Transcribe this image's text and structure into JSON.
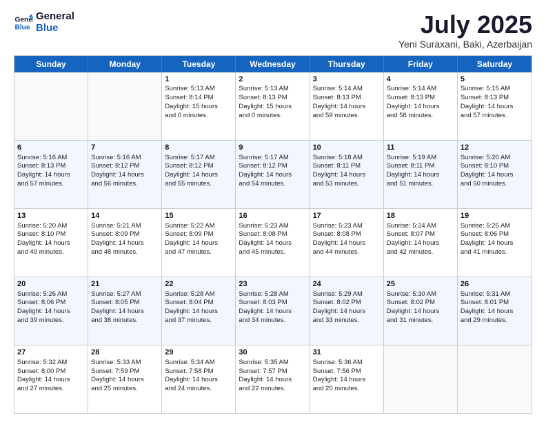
{
  "logo": {
    "line1": "General",
    "line2": "Blue"
  },
  "title": "July 2025",
  "subtitle": "Yeni Suraxani, Baki, Azerbaijan",
  "days": [
    "Sunday",
    "Monday",
    "Tuesday",
    "Wednesday",
    "Thursday",
    "Friday",
    "Saturday"
  ],
  "rows": [
    [
      {
        "day": "",
        "lines": []
      },
      {
        "day": "",
        "lines": []
      },
      {
        "day": "1",
        "lines": [
          "Sunrise: 5:13 AM",
          "Sunset: 8:14 PM",
          "Daylight: 15 hours",
          "and 0 minutes."
        ]
      },
      {
        "day": "2",
        "lines": [
          "Sunrise: 5:13 AM",
          "Sunset: 8:13 PM",
          "Daylight: 15 hours",
          "and 0 minutes."
        ]
      },
      {
        "day": "3",
        "lines": [
          "Sunrise: 5:14 AM",
          "Sunset: 8:13 PM",
          "Daylight: 14 hours",
          "and 59 minutes."
        ]
      },
      {
        "day": "4",
        "lines": [
          "Sunrise: 5:14 AM",
          "Sunset: 8:13 PM",
          "Daylight: 14 hours",
          "and 58 minutes."
        ]
      },
      {
        "day": "5",
        "lines": [
          "Sunrise: 5:15 AM",
          "Sunset: 8:13 PM",
          "Daylight: 14 hours",
          "and 57 minutes."
        ]
      }
    ],
    [
      {
        "day": "6",
        "lines": [
          "Sunrise: 5:16 AM",
          "Sunset: 8:13 PM",
          "Daylight: 14 hours",
          "and 57 minutes."
        ]
      },
      {
        "day": "7",
        "lines": [
          "Sunrise: 5:16 AM",
          "Sunset: 8:12 PM",
          "Daylight: 14 hours",
          "and 56 minutes."
        ]
      },
      {
        "day": "8",
        "lines": [
          "Sunrise: 5:17 AM",
          "Sunset: 8:12 PM",
          "Daylight: 14 hours",
          "and 55 minutes."
        ]
      },
      {
        "day": "9",
        "lines": [
          "Sunrise: 5:17 AM",
          "Sunset: 8:12 PM",
          "Daylight: 14 hours",
          "and 54 minutes."
        ]
      },
      {
        "day": "10",
        "lines": [
          "Sunrise: 5:18 AM",
          "Sunset: 8:11 PM",
          "Daylight: 14 hours",
          "and 53 minutes."
        ]
      },
      {
        "day": "11",
        "lines": [
          "Sunrise: 5:19 AM",
          "Sunset: 8:11 PM",
          "Daylight: 14 hours",
          "and 51 minutes."
        ]
      },
      {
        "day": "12",
        "lines": [
          "Sunrise: 5:20 AM",
          "Sunset: 8:10 PM",
          "Daylight: 14 hours",
          "and 50 minutes."
        ]
      }
    ],
    [
      {
        "day": "13",
        "lines": [
          "Sunrise: 5:20 AM",
          "Sunset: 8:10 PM",
          "Daylight: 14 hours",
          "and 49 minutes."
        ]
      },
      {
        "day": "14",
        "lines": [
          "Sunrise: 5:21 AM",
          "Sunset: 8:09 PM",
          "Daylight: 14 hours",
          "and 48 minutes."
        ]
      },
      {
        "day": "15",
        "lines": [
          "Sunrise: 5:22 AM",
          "Sunset: 8:09 PM",
          "Daylight: 14 hours",
          "and 47 minutes."
        ]
      },
      {
        "day": "16",
        "lines": [
          "Sunrise: 5:23 AM",
          "Sunset: 8:08 PM",
          "Daylight: 14 hours",
          "and 45 minutes."
        ]
      },
      {
        "day": "17",
        "lines": [
          "Sunrise: 5:23 AM",
          "Sunset: 8:08 PM",
          "Daylight: 14 hours",
          "and 44 minutes."
        ]
      },
      {
        "day": "18",
        "lines": [
          "Sunrise: 5:24 AM",
          "Sunset: 8:07 PM",
          "Daylight: 14 hours",
          "and 42 minutes."
        ]
      },
      {
        "day": "19",
        "lines": [
          "Sunrise: 5:25 AM",
          "Sunset: 8:06 PM",
          "Daylight: 14 hours",
          "and 41 minutes."
        ]
      }
    ],
    [
      {
        "day": "20",
        "lines": [
          "Sunrise: 5:26 AM",
          "Sunset: 8:06 PM",
          "Daylight: 14 hours",
          "and 39 minutes."
        ]
      },
      {
        "day": "21",
        "lines": [
          "Sunrise: 5:27 AM",
          "Sunset: 8:05 PM",
          "Daylight: 14 hours",
          "and 38 minutes."
        ]
      },
      {
        "day": "22",
        "lines": [
          "Sunrise: 5:28 AM",
          "Sunset: 8:04 PM",
          "Daylight: 14 hours",
          "and 37 minutes."
        ]
      },
      {
        "day": "23",
        "lines": [
          "Sunrise: 5:28 AM",
          "Sunset: 8:03 PM",
          "Daylight: 14 hours",
          "and 34 minutes."
        ]
      },
      {
        "day": "24",
        "lines": [
          "Sunrise: 5:29 AM",
          "Sunset: 8:02 PM",
          "Daylight: 14 hours",
          "and 33 minutes."
        ]
      },
      {
        "day": "25",
        "lines": [
          "Sunrise: 5:30 AM",
          "Sunset: 8:02 PM",
          "Daylight: 14 hours",
          "and 31 minutes."
        ]
      },
      {
        "day": "26",
        "lines": [
          "Sunrise: 5:31 AM",
          "Sunset: 8:01 PM",
          "Daylight: 14 hours",
          "and 29 minutes."
        ]
      }
    ],
    [
      {
        "day": "27",
        "lines": [
          "Sunrise: 5:32 AM",
          "Sunset: 8:00 PM",
          "Daylight: 14 hours",
          "and 27 minutes."
        ]
      },
      {
        "day": "28",
        "lines": [
          "Sunrise: 5:33 AM",
          "Sunset: 7:59 PM",
          "Daylight: 14 hours",
          "and 25 minutes."
        ]
      },
      {
        "day": "29",
        "lines": [
          "Sunrise: 5:34 AM",
          "Sunset: 7:58 PM",
          "Daylight: 14 hours",
          "and 24 minutes."
        ]
      },
      {
        "day": "30",
        "lines": [
          "Sunrise: 5:35 AM",
          "Sunset: 7:57 PM",
          "Daylight: 14 hours",
          "and 22 minutes."
        ]
      },
      {
        "day": "31",
        "lines": [
          "Sunrise: 5:36 AM",
          "Sunset: 7:56 PM",
          "Daylight: 14 hours",
          "and 20 minutes."
        ]
      },
      {
        "day": "",
        "lines": []
      },
      {
        "day": "",
        "lines": []
      }
    ]
  ]
}
